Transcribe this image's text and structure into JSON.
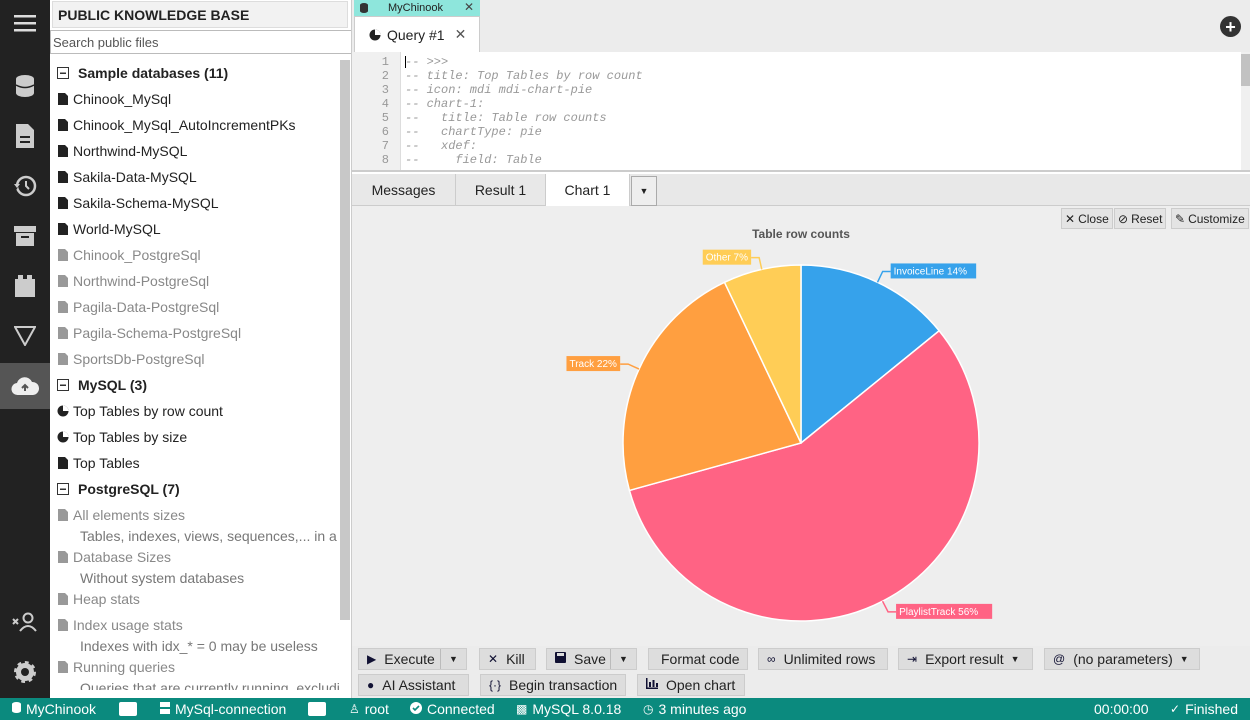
{
  "sidebar": {
    "title": "PUBLIC KNOWLEDGE BASE",
    "search_placeholder": "Search public files",
    "groups": [
      {
        "label": "Sample databases (11)"
      },
      {
        "label": "MySQL (3)"
      },
      {
        "label": "PostgreSQL (7)"
      }
    ],
    "sample_items": [
      "Chinook_MySql",
      "Chinook_MySql_AutoIncrementPKs",
      "Northwind-MySQL",
      "Sakila-Data-MySQL",
      "Sakila-Schema-MySQL",
      "World-MySQL",
      "Chinook_PostgreSql",
      "Northwind-PostgreSql",
      "Pagila-Data-PostgreSql",
      "Pagila-Schema-PostgreSql",
      "SportsDb-PostgreSql"
    ],
    "mysql_items": [
      "Top Tables by row count",
      "Top Tables by size",
      "Top Tables"
    ],
    "pg_items": [
      {
        "label": "All elements sizes",
        "sub": "Tables, indexes, views, sequences,... in a"
      },
      {
        "label": "Database Sizes",
        "sub": "Without system databases"
      },
      {
        "label": "Heap stats",
        "sub": ""
      },
      {
        "label": "Index usage stats",
        "sub": "Indexes with idx_* = 0 may be useless"
      },
      {
        "label": "Running queries",
        "sub": "Queries that are currently running, excludi"
      }
    ]
  },
  "tabs": {
    "connection": "MyChinook",
    "query": "Query #1"
  },
  "editor": {
    "lines": [
      "-- >>>",
      "-- title: Top Tables by row count",
      "-- icon: mdi mdi-chart-pie",
      "-- chart-1:",
      "--   title: Table row counts",
      "--   chartType: pie",
      "--   xdef:",
      "--     field: Table"
    ]
  },
  "result_tabs": [
    "Messages",
    "Result 1",
    "Chart 1"
  ],
  "chart_controls": {
    "close": "Close",
    "reset": "Reset",
    "customize": "Customize"
  },
  "chart_data": {
    "type": "pie",
    "title": "Table row counts",
    "slices": [
      {
        "label": "InvoiceLine",
        "percent": 14,
        "display": "InvoiceLine 14%",
        "color": "#36a2eb"
      },
      {
        "label": "PlaylistTrack",
        "percent": 56,
        "display": "PlaylistTrack 56%",
        "color": "#ff6384"
      },
      {
        "label": "Track",
        "percent": 22,
        "display": "Track 22%",
        "color": "#ff9f40"
      },
      {
        "label": "Other",
        "percent": 7,
        "display": "Other 7%",
        "color": "#ffcd56"
      }
    ]
  },
  "toolbar": {
    "execute": "Execute",
    "kill": "Kill",
    "save": "Save",
    "format": "Format code",
    "unlimited": "Unlimited rows",
    "export": "Export result",
    "params": "(no parameters)",
    "ai": "AI Assistant",
    "begin": "Begin transaction",
    "open_chart": "Open chart"
  },
  "status": {
    "connection": "MyChinook",
    "server": "MySql-connection",
    "user": "root",
    "state": "Connected",
    "version": "MySQL 8.0.18",
    "time_ago": "3 minutes ago",
    "timer": "00:00:00",
    "result": "Finished"
  }
}
